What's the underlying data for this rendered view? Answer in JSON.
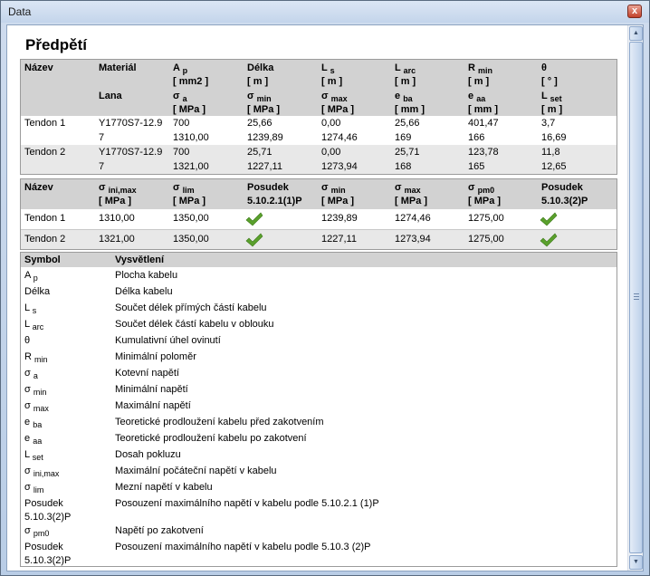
{
  "window": {
    "title": "Data",
    "close_symbol": "x"
  },
  "heading": "Předpětí",
  "table1": {
    "headers_row1": [
      {
        "main": "Název",
        "sub": "",
        "unit": ""
      },
      {
        "main": "Materiál",
        "sub": "",
        "unit": ""
      },
      {
        "main": "A",
        "sub": "p",
        "unit": "[ mm2 ]"
      },
      {
        "main": "Délka",
        "sub": "",
        "unit": "[ m ]"
      },
      {
        "main": "L",
        "sub": "s",
        "unit": "[ m ]"
      },
      {
        "main": "L",
        "sub": "arc",
        "unit": "[ m ]"
      },
      {
        "main": "R",
        "sub": "min",
        "unit": "[ m ]"
      },
      {
        "main": "θ",
        "sub": "",
        "unit": "[ ° ]"
      }
    ],
    "headers_row2": [
      {
        "main": "",
        "sub": "",
        "unit": ""
      },
      {
        "main": "Lana",
        "sub": "",
        "unit": ""
      },
      {
        "main": "σ",
        "sub": "a",
        "unit": "[ MPa ]"
      },
      {
        "main": "σ",
        "sub": "min",
        "unit": "[ MPa ]"
      },
      {
        "main": "σ",
        "sub": "max",
        "unit": "[ MPa ]"
      },
      {
        "main": "e",
        "sub": "ba",
        "unit": "[ mm ]"
      },
      {
        "main": "e",
        "sub": "aa",
        "unit": "[ mm ]"
      },
      {
        "main": "L",
        "sub": "set",
        "unit": "[ m ]"
      }
    ],
    "rows": [
      {
        "line1": [
          "Tendon 1",
          "Y1770S7-12.9",
          "700",
          "25,66",
          "0,00",
          "25,66",
          "401,47",
          "3,7"
        ],
        "line2": [
          "",
          "7",
          "1310,00",
          "1239,89",
          "1274,46",
          "169",
          "166",
          "16,69"
        ]
      },
      {
        "line1": [
          "Tendon 2",
          "Y1770S7-12.9",
          "700",
          "25,71",
          "0,00",
          "25,71",
          "123,78",
          "11,8"
        ],
        "line2": [
          "",
          "7",
          "1321,00",
          "1227,11",
          "1273,94",
          "168",
          "165",
          "12,65"
        ]
      }
    ]
  },
  "table2": {
    "headers": [
      {
        "main": "Název",
        "sub": "",
        "unit": ""
      },
      {
        "main": "σ",
        "sub": "ini,max",
        "unit": "[ MPa ]"
      },
      {
        "main": "σ",
        "sub": "lim",
        "unit": "[ MPa ]"
      },
      {
        "main": "Posudek",
        "sub": "",
        "unit": "5.10.2.1(1)P"
      },
      {
        "main": "σ",
        "sub": "min",
        "unit": "[ MPa ]"
      },
      {
        "main": "σ",
        "sub": "max",
        "unit": "[ MPa ]"
      },
      {
        "main": "σ",
        "sub": "pm0",
        "unit": "[ MPa ]"
      },
      {
        "main": "Posudek",
        "sub": "",
        "unit": "5.10.3(2)P"
      }
    ],
    "rows": [
      {
        "cells": [
          "Tendon 1",
          "1310,00",
          "1350,00",
          "",
          "1239,89",
          "1274,46",
          "1275,00",
          ""
        ],
        "check1": "pass",
        "check2": "pass"
      },
      {
        "cells": [
          "Tendon 2",
          "1321,00",
          "1350,00",
          "",
          "1227,11",
          "1273,94",
          "1275,00",
          ""
        ],
        "check1": "pass",
        "check2": "pass"
      }
    ],
    "check_color": "#5aa02c"
  },
  "table3": {
    "headers": {
      "symbol": "Symbol",
      "explanation": "Vysvětlení"
    },
    "items": [
      {
        "sym": "A",
        "sub": "p",
        "sym2": "",
        "text": "Plocha kabelu"
      },
      {
        "sym": "Délka",
        "sub": "",
        "sym2": "",
        "text": "Délka kabelu"
      },
      {
        "sym": "L",
        "sub": "s",
        "sym2": "",
        "text": "Součet délek přímých částí kabelu"
      },
      {
        "sym": "L",
        "sub": "arc",
        "sym2": "",
        "text": "Součet délek částí kabelu v oblouku"
      },
      {
        "sym": "θ",
        "sub": "",
        "sym2": "",
        "text": "Kumulativní úhel ovinutí"
      },
      {
        "sym": "R",
        "sub": "min",
        "sym2": "",
        "text": "Minimální poloměr"
      },
      {
        "sym": "σ",
        "sub": "a",
        "sym2": "",
        "text": "Kotevní napětí"
      },
      {
        "sym": "σ",
        "sub": "min",
        "sym2": "",
        "text": "Minimální napětí"
      },
      {
        "sym": "σ",
        "sub": "max",
        "sym2": "",
        "text": "Maximální napětí"
      },
      {
        "sym": "e",
        "sub": "ba",
        "sym2": "",
        "text": "Teoretické prodloužení kabelu před zakotvením"
      },
      {
        "sym": "e",
        "sub": "aa",
        "sym2": "",
        "text": "Teoretické prodloužení kabelu po zakotvení"
      },
      {
        "sym": "L",
        "sub": "set",
        "sym2": "",
        "text": "Dosah pokluzu"
      },
      {
        "sym": "σ",
        "sub": "ini,max",
        "sym2": "",
        "text": "Maximální počáteční napětí v kabelu"
      },
      {
        "sym": "σ",
        "sub": "lim",
        "sym2": "",
        "text": "Mezní napětí v kabelu"
      },
      {
        "sym": "Posudek",
        "sub": "",
        "sym2": "5.10.3(2)P",
        "text": "Posouzení maximálního napětí v kabelu podle 5.10.2.1 (1)P"
      },
      {
        "sym": "σ",
        "sub": "pm0",
        "sym2": "",
        "text": "Napětí po zakotvení"
      },
      {
        "sym": "Posudek",
        "sub": "",
        "sym2": "5.10.3(2)P",
        "text": "Posouzení maximálního napětí v kabelu podle 5.10.3 (2)P"
      }
    ]
  }
}
